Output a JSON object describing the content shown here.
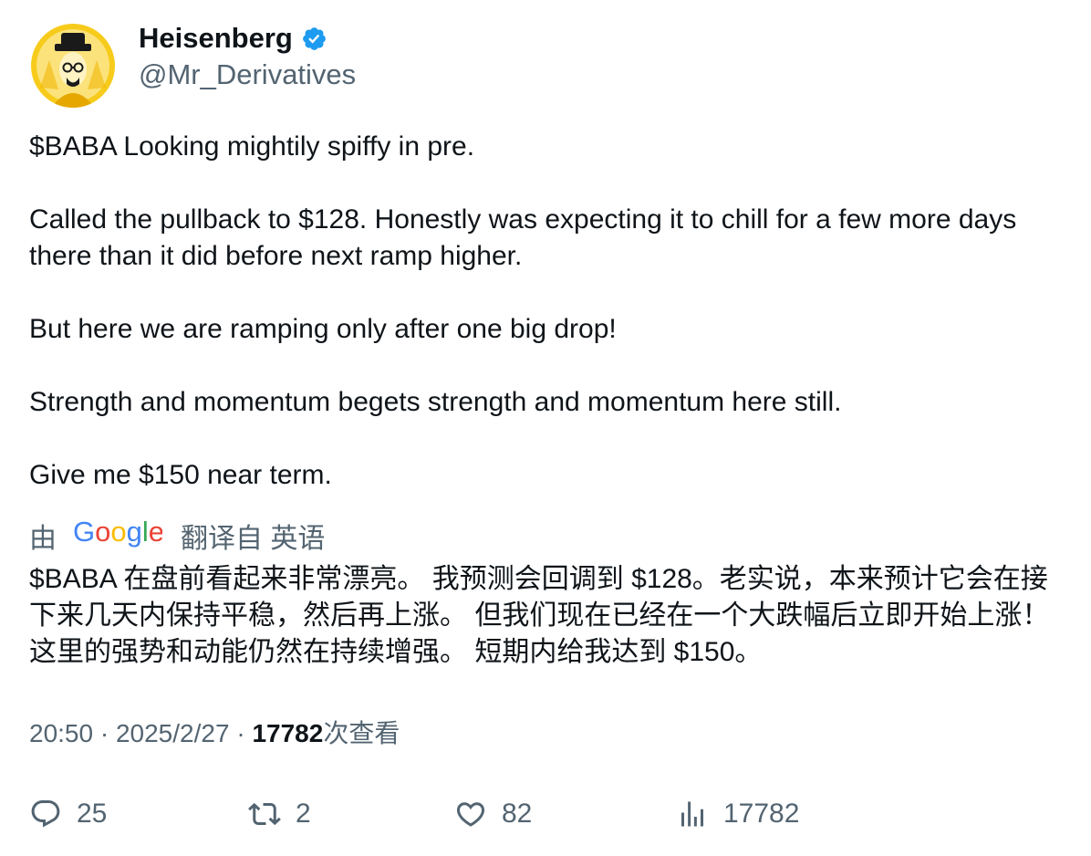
{
  "author": {
    "display_name": "Heisenberg",
    "handle": "@Mr_Derivatives",
    "verified": true,
    "avatar_icon": "heisenberg-portrait-avatar"
  },
  "tweet": {
    "paragraphs": [
      "$BABA Looking mightily spiffy in pre.",
      "Called the pullback to $128. Honestly was expecting it to chill for a few more days there than it did before next ramp higher.",
      "But here we are ramping only after one big drop!",
      "Strength and momentum begets strength and momentum here still.",
      "Give me $150 near term."
    ]
  },
  "translation": {
    "by_label": "由",
    "provider": "Google",
    "from_label": "翻译自 英语",
    "text": "$BABA 在盘前看起来非常漂亮。 我预测会回调到 $128。老实说，本来预计它会在接下来几天内保持平稳，然后再上涨。 但我们现在已经在一个大跌幅后立即开始上涨！ 这里的强势和动能仍然在持续增强。 短期内给我达到 $150。"
  },
  "meta": {
    "time": "20:50",
    "separator": "·",
    "date": "2025/2/27",
    "views": "17782",
    "views_label": "次查看"
  },
  "actions": {
    "replies": "25",
    "retweets": "2",
    "likes": "82",
    "views": "17782"
  },
  "colors": {
    "text_primary": "#0f1419",
    "text_secondary": "#536471",
    "verified_blue": "#1d9bf0",
    "avatar_yellow": "#f5c518"
  }
}
